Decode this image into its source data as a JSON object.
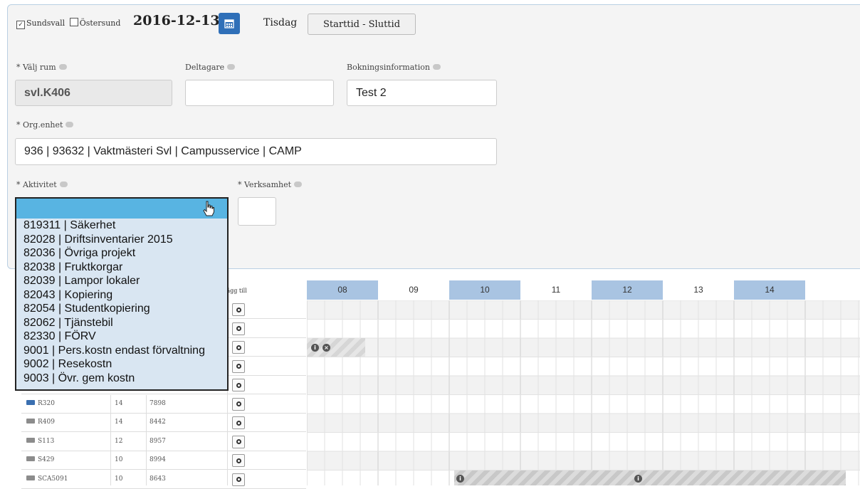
{
  "header": {
    "sites": [
      {
        "label": "Sundsvall",
        "checked": true
      },
      {
        "label": "Östersund",
        "checked": false
      }
    ],
    "date": "2016-12-13",
    "weekday": "Tisdag",
    "time_button": "Starttid - Sluttid"
  },
  "form": {
    "room": {
      "label": "* Välj rum",
      "value": "svl.K406"
    },
    "participants": {
      "label": "Deltagare",
      "value": ""
    },
    "booking_info": {
      "label": "Bokningsinformation",
      "value": "Test 2"
    },
    "org_unit": {
      "label": "* Org.enhet",
      "value": "936 | 93632 | Vaktmästeri Svl | Campusservice | CAMP"
    },
    "activity": {
      "label": "* Aktivitet",
      "value": ""
    },
    "business": {
      "label": "* Verksamhet",
      "value": ""
    }
  },
  "activity_options": [
    "819311 | Säkerhet",
    "82028 | Driftsinventarier 2015",
    "82036 | Övriga projekt",
    "82038 | Fruktkorgar",
    "82039 | Lampor lokaler",
    "82043 | Kopiering",
    "82054 | Studentkopiering",
    "82062 | Tjänstebil",
    "82330 | FÖRV",
    "9001 | Pers.kostn endast förvaltning",
    "9002 | Resekostn",
    "9003 | Övr. gem kostn"
  ],
  "table": {
    "add_header": "Lägg till",
    "rows": [
      {
        "room": "R320",
        "seats": "14",
        "number": "7898",
        "icon": "blue"
      },
      {
        "room": "R409",
        "seats": "14",
        "number": "8442",
        "icon": "grey"
      },
      {
        "room": "S113",
        "seats": "12",
        "number": "8957",
        "icon": "grey"
      },
      {
        "room": "S429",
        "seats": "10",
        "number": "8994",
        "icon": "grey"
      },
      {
        "room": "SCA5091",
        "seats": "10",
        "number": "8643",
        "icon": "grey"
      }
    ]
  },
  "schedule": {
    "hours": [
      "08",
      "09",
      "10",
      "11",
      "12",
      "13",
      "14"
    ]
  },
  "colors": {
    "accent": "#2f6fb8",
    "highlight": "#58b4e2",
    "hour_blue": "#a9c4e2"
  }
}
